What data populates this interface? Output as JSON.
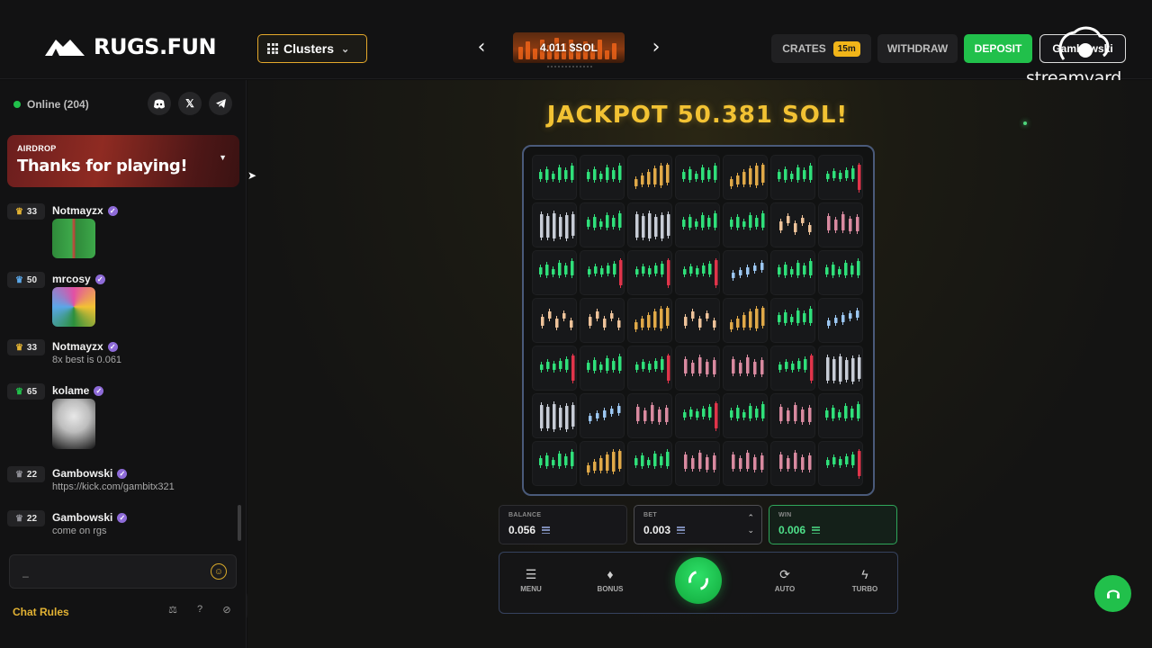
{
  "header": {
    "logo_text": "RUGS.FUN",
    "clusters_label": "Clusters",
    "ticker_value": "4.011 $SOL",
    "crates_label": "CRATES",
    "crates_badge": "15m",
    "withdraw_label": "WITHDRAW",
    "deposit_label": "DEPOSIT",
    "username": "Gambowski",
    "streamyard_label": "streamyard"
  },
  "sidebar": {
    "online_label": "Online (204)",
    "social": [
      "discord-icon",
      "x-icon",
      "telegram-icon"
    ],
    "airdrop": {
      "tag": "AIRDROP",
      "title": "Thanks for playing!"
    },
    "messages": [
      {
        "level": "33",
        "user": "Notmayzx",
        "text": "",
        "emote": "frog-emote",
        "emote_colors": [
          "#2f8a3a",
          "#d23b3b"
        ]
      },
      {
        "level": "50",
        "user": "mrcosy",
        "text": "",
        "emote": "rainbow-frog-emote",
        "emote_colors": [
          "#2b8f3c",
          "#e24fa5"
        ]
      },
      {
        "level": "33",
        "user": "Notmayzx",
        "text": "8x best is 0.061",
        "emote": ""
      },
      {
        "level": "65",
        "user": "kolame",
        "text": "",
        "emote": "shark-emote",
        "emote_colors": [
          "#d9d9d9",
          "#6a6a6a"
        ]
      },
      {
        "level": "22",
        "user": "Gambowski",
        "text": "https://kick.com/gambitx321",
        "emote": ""
      },
      {
        "level": "22",
        "user": "Gambowski",
        "text": "come on rgs",
        "emote": ""
      }
    ],
    "level_colors": {
      "33": "#e2b233",
      "50": "#5aa7e8",
      "65": "#21c04b",
      "22": "#8f8f96"
    },
    "chat_input_value": "_",
    "chat_rules_label": "Chat Rules"
  },
  "game": {
    "jackpot_label": "JACKPOT 50.381 SOL!",
    "grid": [
      [
        "green",
        "green",
        "gold",
        "green",
        "gold",
        "green",
        "red"
      ],
      [
        "white",
        "green",
        "white",
        "green",
        "green",
        "peach",
        "pink"
      ],
      [
        "green",
        "red",
        "red",
        "red",
        "blue",
        "green",
        "green"
      ],
      [
        "peach",
        "peach",
        "gold",
        "peach",
        "gold",
        "green",
        "blue"
      ],
      [
        "red",
        "green",
        "red",
        "pink",
        "pink",
        "red",
        "white"
      ],
      [
        "white",
        "blue",
        "pink",
        "red",
        "green",
        "pink",
        "green"
      ],
      [
        "green",
        "gold",
        "green",
        "pink",
        "pink",
        "pink",
        "red"
      ]
    ],
    "candle_colors": {
      "green": "#2fe07a",
      "red": "#e0344a",
      "gold": "#e0a948",
      "white": "#c7ccd6",
      "peach": "#eec39a",
      "pink": "#d98aa0",
      "blue": "#9cc7f2"
    },
    "balance": {
      "label": "BALANCE",
      "value": "0.056"
    },
    "bet": {
      "label": "BET",
      "value": "0.003"
    },
    "win": {
      "label": "WIN",
      "value": "0.006"
    },
    "controls": {
      "menu": "MENU",
      "bonus": "BONUS",
      "auto": "AUTO",
      "turbo": "TURBO"
    }
  }
}
